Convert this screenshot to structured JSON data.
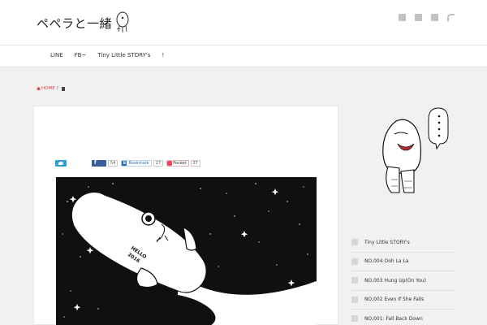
{
  "header": {
    "site_title": "ペペラと一緒",
    "social_icons": [
      "facebook-icon",
      "twitter-icon",
      "google-plus-icon",
      "rss-icon"
    ]
  },
  "nav": {
    "items": [
      "LINE",
      "FB~",
      "Tiny Little STORY's",
      "!"
    ]
  },
  "breadcrumb": {
    "home": "HOME",
    "separator": "/"
  },
  "share": {
    "facebook_label": "f",
    "facebook_count": "54",
    "hatena_label": "Bookmark",
    "hatena_icon": "B",
    "hatena_count": "27",
    "pocket_label": "Pocket",
    "pocket_count": "37"
  },
  "artwork": {
    "rocket_text_line1": "HELLO",
    "rocket_text_line2": "2016"
  },
  "sidebar": {
    "items": [
      {
        "label": "Tiny Little STORY's"
      },
      {
        "label": "NO,004 Ooh La La"
      },
      {
        "label": "NO,003 Hung Up(On You)"
      },
      {
        "label": "NO,002 Even If She Falls"
      },
      {
        "label": "NO,001: Fall Back Down"
      }
    ]
  },
  "colors": {
    "accent_red": "#d94c4c",
    "twitter": "#2ea0d8",
    "facebook": "#3b5b9c",
    "hatena": "#2c6ebd",
    "pocket": "#ee4056"
  }
}
